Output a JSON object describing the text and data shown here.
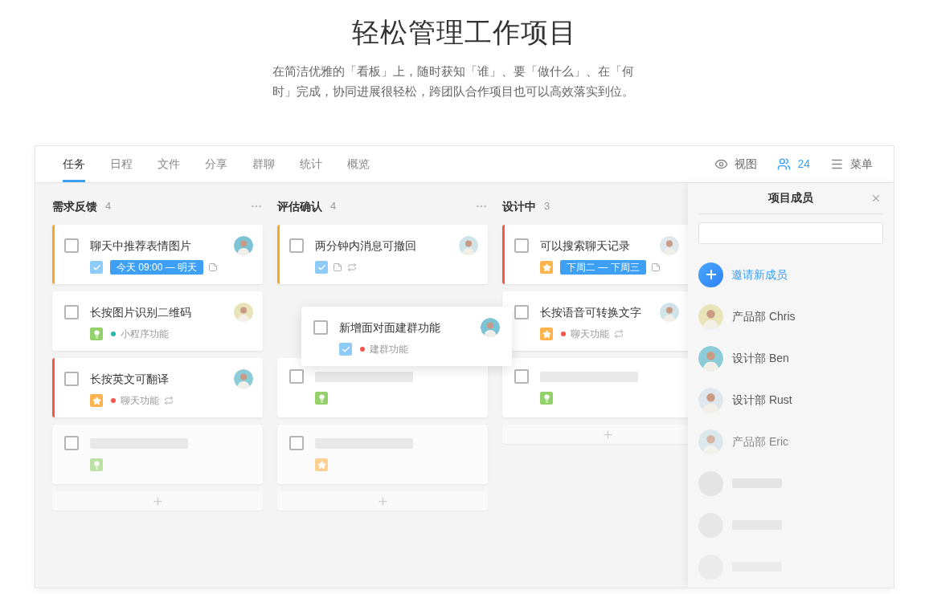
{
  "heading": "轻松管理工作项目",
  "subtitle": "在简洁优雅的「看板」上，随时获知「谁」、要「做什么」、在「何时」完成，协同进展很轻松，跨团队合作项目也可以高效落实到位。",
  "tabs": [
    {
      "label": "任务",
      "selected": true
    },
    {
      "label": "日程",
      "selected": false
    },
    {
      "label": "文件",
      "selected": false
    },
    {
      "label": "分享",
      "selected": false
    },
    {
      "label": "群聊",
      "selected": false
    },
    {
      "label": "统计",
      "selected": false
    },
    {
      "label": "概览",
      "selected": false
    }
  ],
  "toolbar": [
    {
      "kind": "view",
      "label": "视图"
    },
    {
      "kind": "members",
      "label": "24"
    },
    {
      "kind": "menu",
      "label": "菜单"
    }
  ],
  "columns": [
    {
      "name": "需求反馈",
      "count": "4",
      "cards": [
        {
          "kind": "task",
          "title": "聊天中推荐表情图片",
          "checked": false,
          "stripe": {
            "color": "#f8a628"
          },
          "tag": {
            "kind": "check"
          },
          "date": "今天 09:00 — 明天",
          "note": true,
          "avatar": true
        },
        {
          "kind": "task",
          "title": "长按图片识别二维码",
          "checked": false,
          "tag": {
            "kind": "bulb"
          },
          "label": {
            "text": "小程序功能",
            "color": "#26b5a8"
          },
          "avatar": true
        },
        {
          "kind": "task",
          "title": "长按英文可翻译",
          "checked": false,
          "stripe": {
            "color": "#f5564a"
          },
          "tag": {
            "kind": "star"
          },
          "label": {
            "text": "聊天功能",
            "color": "#f5564a"
          },
          "repeat": true,
          "avatar": true
        },
        {
          "kind": "skeleton",
          "checked": false,
          "tag": {
            "kind": "bulb"
          }
        }
      ]
    },
    {
      "name": "评估确认",
      "count": "4",
      "cards": [
        {
          "kind": "task",
          "title": "两分钟内消息可撤回",
          "checked": false,
          "stripe": {
            "color": "#f8a628"
          },
          "tag": {
            "kind": "check"
          },
          "note": true,
          "repeat": true,
          "avatar": true
        },
        {
          "kind": "dragging",
          "title": "新增面对面建群功能",
          "checked": false,
          "tag": {
            "kind": "check"
          },
          "label": {
            "text": "建群功能",
            "color": "#f5564a"
          },
          "avatar": true
        },
        {
          "kind": "skeleton",
          "checked": false,
          "tag": {
            "kind": "bulb"
          }
        },
        {
          "kind": "skeleton",
          "checked": false,
          "tag": {
            "kind": "star"
          }
        }
      ]
    },
    {
      "name": "设计中",
      "count": "3",
      "cards": [
        {
          "kind": "task",
          "title": "可以搜索聊天记录",
          "checked": false,
          "stripe": {
            "color": "#f5564a"
          },
          "tag": {
            "kind": "star"
          },
          "date": "下周二 — 下周三",
          "note": true,
          "avatar": true
        },
        {
          "kind": "task",
          "title": "长按语音可转换文字",
          "checked": false,
          "tag": {
            "kind": "star"
          },
          "label": {
            "text": "聊天功能",
            "color": "#f5564a"
          },
          "repeat": true,
          "avatar": true
        },
        {
          "kind": "skeleton",
          "checked": false,
          "tag": {
            "kind": "bulb"
          }
        }
      ]
    }
  ],
  "members_panel": {
    "title": "项目成员",
    "invite": "邀请新成员",
    "members": [
      {
        "kind": "member",
        "name": "产品部 Chris"
      },
      {
        "kind": "member",
        "name": "设计部 Ben"
      },
      {
        "kind": "member",
        "name": "设计部 Rust"
      },
      {
        "kind": "member",
        "name": "产品部 Eric"
      },
      {
        "kind": "skeleton"
      },
      {
        "kind": "skeleton"
      },
      {
        "kind": "skeleton"
      }
    ]
  }
}
